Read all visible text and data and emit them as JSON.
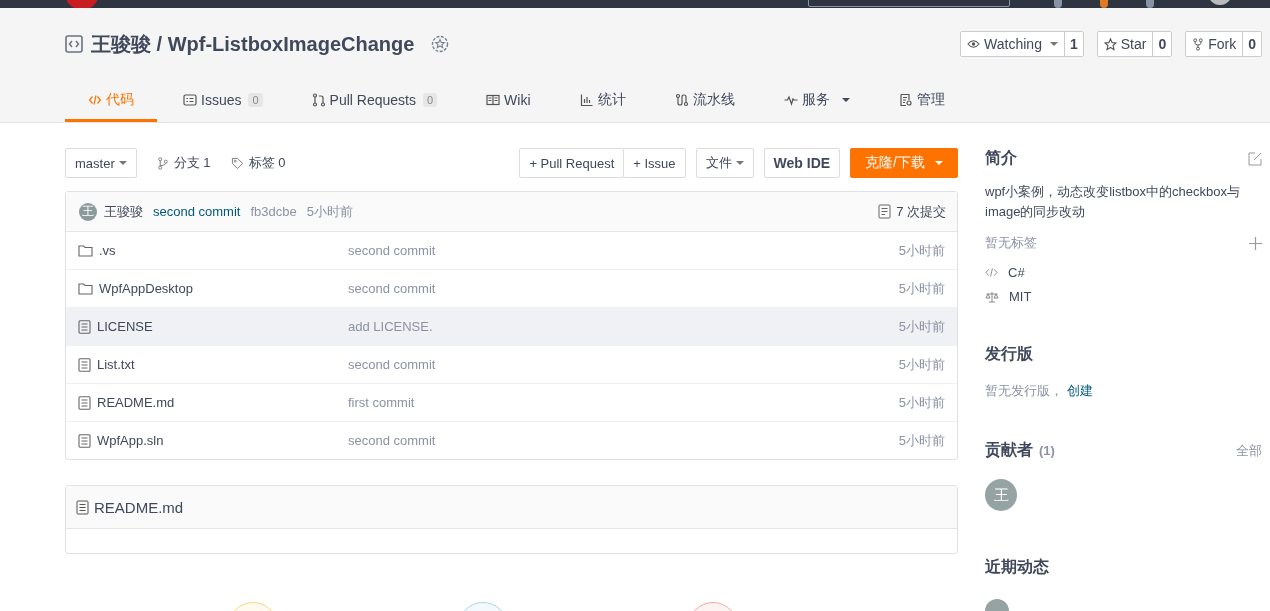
{
  "repo": {
    "title": "王骏骏 / Wpf-ListboxImageChange"
  },
  "actions": [
    {
      "kind": "watch",
      "label": "Watching",
      "count": "1",
      "dropdown": true
    },
    {
      "kind": "star",
      "label": "Star",
      "count": "0",
      "dropdown": false
    },
    {
      "kind": "fork",
      "label": "Fork",
      "count": "0",
      "dropdown": false
    }
  ],
  "tabs": [
    {
      "label": "代码",
      "selected": true,
      "dropdown": false
    },
    {
      "label": "Issues",
      "count": "0",
      "selected": false,
      "dropdown": false
    },
    {
      "label": "Pull Requests",
      "count": "0",
      "selected": false,
      "dropdown": false
    },
    {
      "label": "Wiki",
      "selected": false,
      "dropdown": false
    },
    {
      "label": "统计",
      "selected": false,
      "dropdown": false
    },
    {
      "label": "流水线",
      "selected": false,
      "dropdown": false
    },
    {
      "label": "服务",
      "selected": false,
      "dropdown": true
    },
    {
      "label": "管理",
      "selected": false,
      "dropdown": false
    }
  ],
  "toolbar": {
    "branch": "master",
    "branches": "分支 1",
    "tags": "标签 0",
    "pull_request": "+ Pull Request",
    "issue": "+ Issue",
    "files": "文件",
    "web_ide": "Web IDE",
    "clone": "克隆/下载"
  },
  "last_commit": {
    "avatar": "王",
    "author": "王骏骏",
    "message": "second commit",
    "hash": "fb3dcbe",
    "time": "5小时前",
    "commits": "7 次提交"
  },
  "files": [
    {
      "kind": "folder",
      "name": ".vs",
      "message": "second commit",
      "time": "5小时前",
      "highlighted": false
    },
    {
      "kind": "folder",
      "name": "WpfAppDesktop",
      "message": "second commit",
      "time": "5小时前",
      "highlighted": false
    },
    {
      "kind": "file",
      "name": "LICENSE",
      "message": "add LICENSE.",
      "time": "5小时前",
      "highlighted": true
    },
    {
      "kind": "file",
      "name": "List.txt",
      "message": "second commit",
      "time": "5小时前",
      "highlighted": false
    },
    {
      "kind": "file",
      "name": "README.md",
      "message": "first commit",
      "time": "5小时前",
      "highlighted": false
    },
    {
      "kind": "file",
      "name": "WpfApp.sln",
      "message": "second commit",
      "time": "5小时前",
      "highlighted": false
    }
  ],
  "readme": {
    "title": "README.md"
  },
  "sidebar": {
    "intro": {
      "title": "简介",
      "description": "wpf小案例，动态改变listbox中的checkbox与image的同步改动",
      "no_tags": "暂无标签",
      "language": "C#",
      "license": "MIT"
    },
    "releases": {
      "title": "发行版",
      "none": "暂无发行版，",
      "create": "创建"
    },
    "contributors": {
      "title": "贡献者",
      "count": "(1)",
      "all": "全部",
      "avatars": [
        "王"
      ]
    },
    "activity": {
      "title": "近期动态"
    }
  }
}
